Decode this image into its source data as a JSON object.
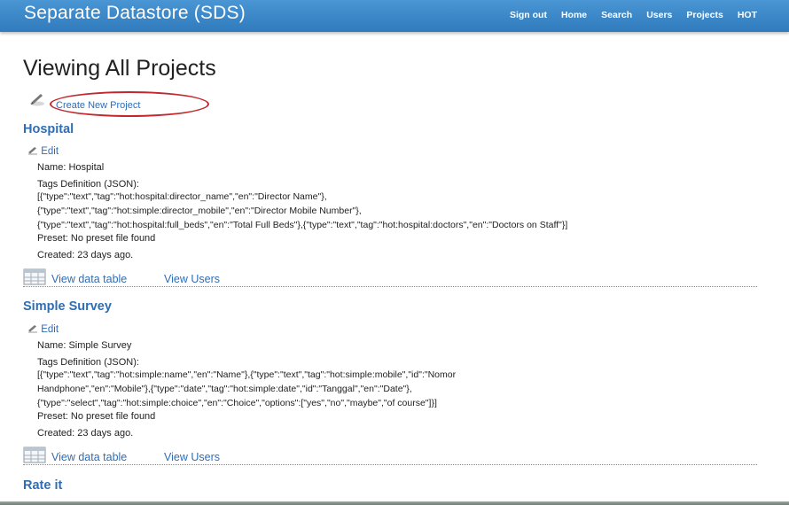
{
  "app": {
    "title": "Separate Datastore (SDS)"
  },
  "nav": {
    "items": [
      "Sign out",
      "Home",
      "Search",
      "Users",
      "Projects",
      "HOT"
    ]
  },
  "page": {
    "title": "Viewing All Projects"
  },
  "create": {
    "label": "Create New Project"
  },
  "projects": [
    {
      "title": "Hospital",
      "edit_label": "Edit",
      "name_line": "Name: Hospital",
      "tags_label": "Tags Definition (JSON):",
      "json_lines": [
        "[{\"type\":\"text\",\"tag\":\"hot:hospital:director_name\",\"en\":\"Director Name\"},",
        "{\"type\":\"text\",\"tag\":\"hot:simple:director_mobile\",\"en\":\"Director Mobile Number\"},",
        "{\"type\":\"text\",\"tag\":\"hot:hospital:full_beds\",\"en\":\"Total Full Beds\"},{\"type\":\"text\",\"tag\":\"hot:hospital:doctors\",\"en\":\"Doctors on Staff\"}]"
      ],
      "preset_line": "Preset: No preset file found",
      "created_line": "Created: 23 days ago.",
      "view_table_label": "View data table",
      "view_users_label": "View Users"
    },
    {
      "title": "Simple Survey",
      "edit_label": "Edit",
      "name_line": "Name: Simple Survey",
      "tags_label": "Tags Definition (JSON):",
      "json_lines": [
        "[{\"type\":\"text\",\"tag\":\"hot:simple:name\",\"en\":\"Name\"},{\"type\":\"text\",\"tag\":\"hot:simple:mobile\",\"id\":\"Nomor",
        "Handphone\",\"en\":\"Mobile\"},{\"type\":\"date\",\"tag\":\"hot:simple:date\",\"id\":\"Tanggal\",\"en\":\"Date\"},",
        "{\"type\":\"select\",\"tag\":\"hot:simple:choice\",\"en\":\"Choice\",\"options\":[\"yes\",\"no\",\"maybe\",\"of course\"]}]"
      ],
      "preset_line": "Preset: No preset file found",
      "created_line": "Created: 23 days ago.",
      "view_table_label": "View data table",
      "view_users_label": "View Users"
    },
    {
      "title": "Rate it"
    }
  ],
  "colors": {
    "header": "#3a88c9",
    "link": "#2f6db5",
    "annotation": "#c0282c"
  }
}
